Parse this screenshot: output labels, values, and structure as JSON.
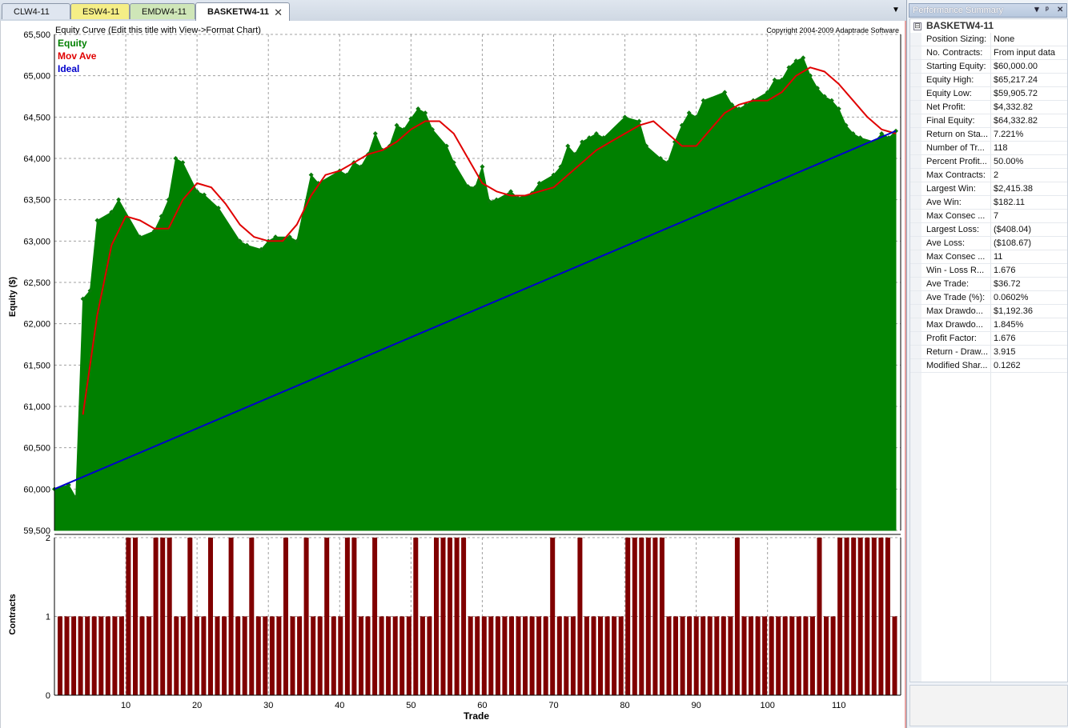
{
  "tabs": [
    {
      "label": "CLW4-11",
      "color": "#dfe6f0"
    },
    {
      "label": "ESW4-11",
      "color": "#f5ee86"
    },
    {
      "label": "EMDW4-11",
      "color": "#cfe6b8"
    },
    {
      "label": "BASKETW4-11",
      "color": "#ffffff",
      "active": true,
      "close": "✕"
    }
  ],
  "chart_header": {
    "title": "Equity Curve (Edit this title with View->Format Chart)",
    "copyright": "Copyright 2004-2009 Adaptrade Software"
  },
  "colors": {
    "equity": "#008000",
    "mov_ave": "#e00000",
    "ideal": "#0000cc",
    "contracts": "#800000",
    "grid": "#a0a0a0"
  },
  "chart_data": [
    {
      "type": "area",
      "ylabel": "Equity ($)",
      "ylim": [
        59500,
        65500
      ],
      "yticks": [
        "59,500",
        "60,000",
        "60,500",
        "61,000",
        "61,500",
        "62,000",
        "62,500",
        "63,000",
        "63,500",
        "64,000",
        "64,500",
        "65,000",
        "65,500"
      ],
      "ytick_values": [
        59500,
        60000,
        60500,
        61000,
        61500,
        62000,
        62500,
        63000,
        63500,
        64000,
        64500,
        65000,
        65500
      ],
      "xlim": [
        0,
        118
      ],
      "grid": true,
      "legend_placement": "top-left",
      "series": [
        {
          "name": "Equity",
          "type": "area",
          "x": [
            0,
            2,
            3,
            4,
            5,
            6,
            8,
            9,
            12,
            14,
            15,
            16,
            17,
            18,
            20,
            21,
            23,
            26,
            27,
            29,
            30,
            31,
            33,
            34,
            36,
            37,
            40,
            41,
            42,
            43,
            44,
            45,
            46,
            47,
            48,
            49,
            50,
            51,
            52,
            53,
            55,
            56,
            58,
            59,
            60,
            61,
            62,
            64,
            65,
            67,
            68,
            70,
            71,
            72,
            73,
            74,
            75,
            76,
            77,
            80,
            82,
            83,
            85,
            86,
            87,
            88,
            89,
            90,
            91,
            94,
            95,
            96,
            97,
            98,
            100,
            101,
            102,
            103,
            104,
            105,
            106,
            107,
            108,
            109,
            110,
            111,
            112,
            113,
            115,
            116,
            117,
            118
          ],
          "y": [
            60000,
            60050,
            59900,
            62300,
            62400,
            63250,
            63350,
            63500,
            63050,
            63120,
            63300,
            63500,
            64000,
            63950,
            63600,
            63560,
            63400,
            63000,
            62950,
            62900,
            63000,
            63050,
            63050,
            63000,
            63800,
            63700,
            63850,
            63800,
            63950,
            63900,
            64050,
            64300,
            64100,
            64150,
            64400,
            64350,
            64480,
            64600,
            64550,
            64350,
            64150,
            63950,
            63660,
            63650,
            63900,
            63480,
            63500,
            63600,
            63520,
            63580,
            63700,
            63800,
            63900,
            64150,
            64050,
            64200,
            64250,
            64300,
            64250,
            64500,
            64450,
            64150,
            64000,
            63950,
            64200,
            64400,
            64550,
            64500,
            64700,
            64800,
            64650,
            64600,
            64650,
            64700,
            64800,
            64950,
            64950,
            65100,
            65180,
            65217,
            65000,
            64850,
            64750,
            64700,
            64600,
            64400,
            64300,
            64250,
            64200,
            64300,
            64250,
            64332
          ]
        },
        {
          "name": "Mov Ave",
          "type": "line",
          "x": [
            4,
            6,
            8,
            10,
            12,
            14,
            16,
            18,
            20,
            22,
            24,
            26,
            28,
            30,
            32,
            34,
            36,
            38,
            40,
            42,
            44,
            46,
            48,
            50,
            52,
            54,
            56,
            58,
            60,
            62,
            64,
            66,
            68,
            70,
            72,
            74,
            76,
            78,
            80,
            82,
            84,
            86,
            88,
            90,
            92,
            94,
            96,
            98,
            100,
            102,
            104,
            106,
            108,
            110,
            112,
            114,
            116,
            118
          ],
          "y": [
            60900,
            62100,
            62950,
            63300,
            63250,
            63150,
            63150,
            63500,
            63700,
            63650,
            63450,
            63200,
            63050,
            63000,
            63000,
            63200,
            63550,
            63800,
            63850,
            63950,
            64050,
            64100,
            64200,
            64350,
            64450,
            64450,
            64300,
            64000,
            63700,
            63600,
            63550,
            63550,
            63600,
            63650,
            63800,
            63950,
            64100,
            64200,
            64300,
            64400,
            64450,
            64300,
            64150,
            64150,
            64350,
            64550,
            64650,
            64700,
            64700,
            64800,
            65000,
            65100,
            65050,
            64900,
            64700,
            64500,
            64350,
            64300
          ]
        },
        {
          "name": "Ideal",
          "type": "line",
          "x": [
            0,
            118
          ],
          "y": [
            60000,
            64332.82
          ]
        }
      ]
    },
    {
      "type": "bar",
      "ylabel": "Contracts",
      "xlabel": "Trade",
      "ylim": [
        0,
        2
      ],
      "yticks": [
        "0",
        "1",
        "2"
      ],
      "xticks": [
        "10",
        "20",
        "30",
        "40",
        "50",
        "60",
        "70",
        "80",
        "90",
        "100",
        "110"
      ],
      "xtick_values": [
        10,
        20,
        30,
        40,
        50,
        60,
        70,
        80,
        90,
        100,
        110
      ],
      "xlim": [
        0,
        118
      ],
      "values": [
        1,
        1,
        1,
        1,
        1,
        1,
        1,
        1,
        1,
        1,
        2,
        2,
        1,
        1,
        2,
        2,
        2,
        1,
        1,
        2,
        1,
        1,
        2,
        1,
        1,
        2,
        1,
        1,
        2,
        1,
        1,
        1,
        1,
        2,
        1,
        1,
        2,
        1,
        1,
        2,
        1,
        1,
        2,
        2,
        1,
        1,
        2,
        1,
        1,
        1,
        1,
        1,
        2,
        1,
        1,
        2,
        2,
        2,
        2,
        2,
        1,
        1,
        1,
        1,
        1,
        1,
        1,
        1,
        1,
        1,
        1,
        1,
        2,
        1,
        1,
        1,
        2,
        1,
        1,
        1,
        1,
        1,
        1,
        2,
        2,
        2,
        2,
        2,
        2,
        1,
        1,
        1,
        1,
        1,
        1,
        1,
        1,
        1,
        1,
        2,
        1,
        1,
        1,
        1,
        1,
        1,
        1,
        1,
        1,
        1,
        1,
        2,
        1,
        1,
        2,
        2,
        2,
        2,
        2,
        2,
        2,
        2,
        1
      ]
    }
  ],
  "panel": {
    "header": "Performance Summary",
    "controls": [
      "▼",
      "ᵖ",
      "✕"
    ],
    "section": "BASKETW4-11",
    "collapse": "⊟",
    "rows": [
      {
        "key": "Position Sizing:",
        "value": "None"
      },
      {
        "key": "No. Contracts:",
        "value": "From input data"
      },
      {
        "key": "Starting Equity:",
        "value": "$60,000.00"
      },
      {
        "key": "Equity High:",
        "value": "$65,217.24"
      },
      {
        "key": "Equity Low:",
        "value": "$59,905.72"
      },
      {
        "key": "Net Profit:",
        "value": "$4,332.82"
      },
      {
        "key": "Final Equity:",
        "value": "$64,332.82"
      },
      {
        "key": "Return on Sta...",
        "value": "7.221%"
      },
      {
        "key": "Number of Tr...",
        "value": "118"
      },
      {
        "key": "Percent Profit...",
        "value": "50.00%"
      },
      {
        "key": "Max Contracts:",
        "value": "2"
      },
      {
        "key": "Largest Win:",
        "value": "$2,415.38"
      },
      {
        "key": "Ave Win:",
        "value": "$182.11"
      },
      {
        "key": "Max Consec ...",
        "value": "7"
      },
      {
        "key": "Largest Loss:",
        "value": "($408.04)"
      },
      {
        "key": "Ave Loss:",
        "value": "($108.67)"
      },
      {
        "key": "Max Consec ...",
        "value": "11"
      },
      {
        "key": "Win - Loss R...",
        "value": "1.676"
      },
      {
        "key": "Ave Trade:",
        "value": "$36.72"
      },
      {
        "key": "Ave Trade (%):",
        "value": "0.0602%"
      },
      {
        "key": "Max Drawdo...",
        "value": "$1,192.36"
      },
      {
        "key": "Max Drawdo...",
        "value": "1.845%"
      },
      {
        "key": "Profit Factor:",
        "value": "1.676"
      },
      {
        "key": "Return - Draw...",
        "value": "3.915"
      },
      {
        "key": "Modified Shar...",
        "value": "0.1262"
      }
    ]
  }
}
